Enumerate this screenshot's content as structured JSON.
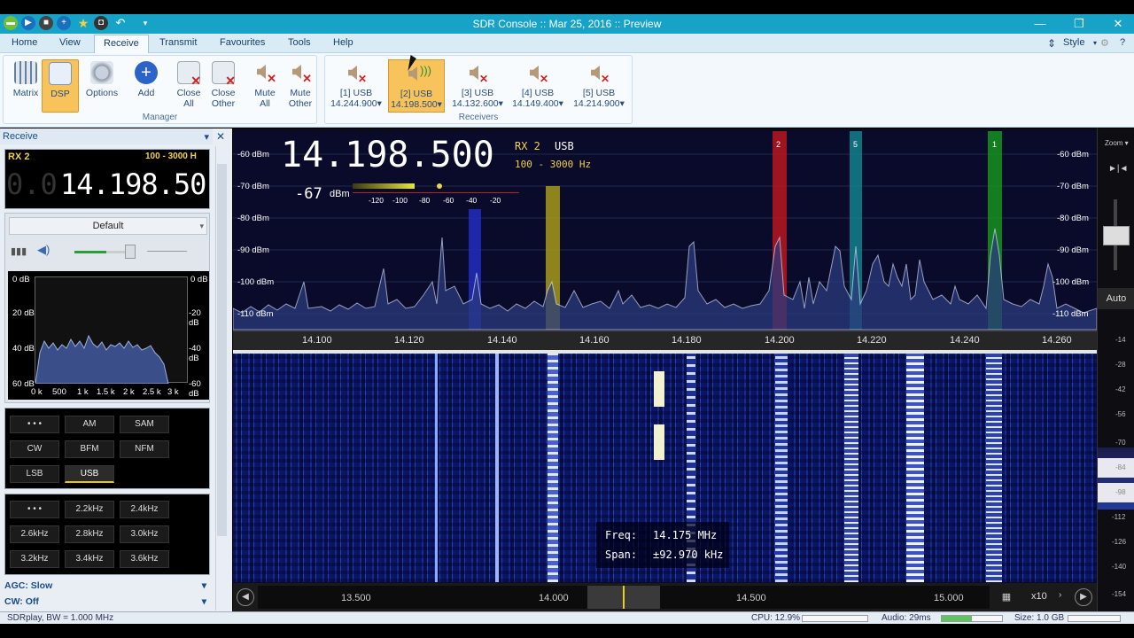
{
  "app": {
    "title": "SDR Console :: Mar 25, 2016 :: Preview",
    "style_label": "Style"
  },
  "menu": [
    "Home",
    "View",
    "Receive",
    "Transmit",
    "Favourites",
    "Tools",
    "Help"
  ],
  "ribbon": {
    "manager_title": "Manager",
    "receivers_title": "Receivers",
    "manager_buttons": [
      {
        "label1": "Matrix",
        "label2": ""
      },
      {
        "label1": "DSP",
        "label2": ""
      },
      {
        "label1": "Options",
        "label2": ""
      },
      {
        "label1": "Add",
        "label2": ""
      },
      {
        "label1": "Close",
        "label2": "All"
      },
      {
        "label1": "Close",
        "label2": "Other"
      },
      {
        "label1": "Mute",
        "label2": "All"
      },
      {
        "label1": "Mute",
        "label2": "Other"
      }
    ],
    "receivers": [
      {
        "label": "[1]  USB",
        "freq": "14.244.900"
      },
      {
        "label": "[2]  USB",
        "freq": "14.198.500"
      },
      {
        "label": "[3]  USB",
        "freq": "14.132.600"
      },
      {
        "label": "[4]  USB",
        "freq": "14.149.400"
      },
      {
        "label": "[5]  USB",
        "freq": "14.214.900"
      }
    ]
  },
  "left": {
    "panel_title": "Receive",
    "rx_label": "RX 2",
    "bandwidth": "100 - 3000 H",
    "freq_dim": "0.0",
    "freq": "14.198.50",
    "preset": "Default",
    "audio_labels_left": [
      "0 dB",
      "20 dB",
      "40 dB",
      "60 dB"
    ],
    "audio_labels_right": [
      "0 dB",
      "-20 dB",
      "-40 dB",
      "-60 dB"
    ],
    "audio_x_labels": [
      "0 k",
      "500",
      "1 k",
      "1.5 k",
      "2 k",
      "2.5 k",
      "3 k"
    ],
    "modes": [
      "• • •",
      "AM",
      "SAM",
      "CW",
      "BFM",
      "NFM",
      "LSB",
      "USB"
    ],
    "filters": [
      "• • •",
      "2.2kHz",
      "2.4kHz",
      "2.6kHz",
      "2.8kHz",
      "3.0kHz",
      "3.2kHz",
      "3.4kHz",
      "3.6kHz"
    ],
    "agc": "AGC: Slow",
    "cw": "CW: Off"
  },
  "spectrum": {
    "freq": "14.198.500",
    "rx": "RX 2",
    "mode": "USB",
    "bw": "100 - 3000 Hz",
    "level": "-67",
    "level_unit": "dBm",
    "smeter_labels": [
      "-120",
      "-100",
      "-80",
      "-60",
      "-40",
      "-20"
    ],
    "db_labels": [
      "-60 dBm",
      "-70 dBm",
      "-80 dBm",
      "-90 dBm",
      "-100 dBm",
      "-110 dBm"
    ],
    "freq_ticks": [
      "14.100",
      "14.120",
      "14.140",
      "14.160",
      "14.180",
      "14.200",
      "14.220",
      "14.240",
      "14.260"
    ],
    "markers": [
      {
        "num": "2",
        "color": "#d21f2b"
      },
      {
        "num": "5",
        "color": "#1aa3b0"
      },
      {
        "num": "1",
        "color": "#1db52a"
      }
    ]
  },
  "waterfall": {
    "freq_label": "Freq:",
    "freq_value": "14.175 MHz",
    "span_label": "Span:",
    "span_value": "±92.970 kHz"
  },
  "bottom": {
    "ticks": [
      "13.500",
      "14.000",
      "14.500",
      "15.000"
    ],
    "zoom": "x10"
  },
  "right": {
    "zoom_label": "Zoom ▾",
    "auto_label": "Auto",
    "scale": [
      "-14",
      "-28",
      "-42",
      "-56",
      "-70",
      "-84",
      "-98",
      "-112",
      "-126",
      "-140",
      "-154"
    ]
  },
  "status": {
    "device": "SDRplay, BW = 1.000 MHz",
    "cpu": "CPU: 12.9%",
    "audio": "Audio: 29ms",
    "size": "Size: 1.0 GB"
  }
}
